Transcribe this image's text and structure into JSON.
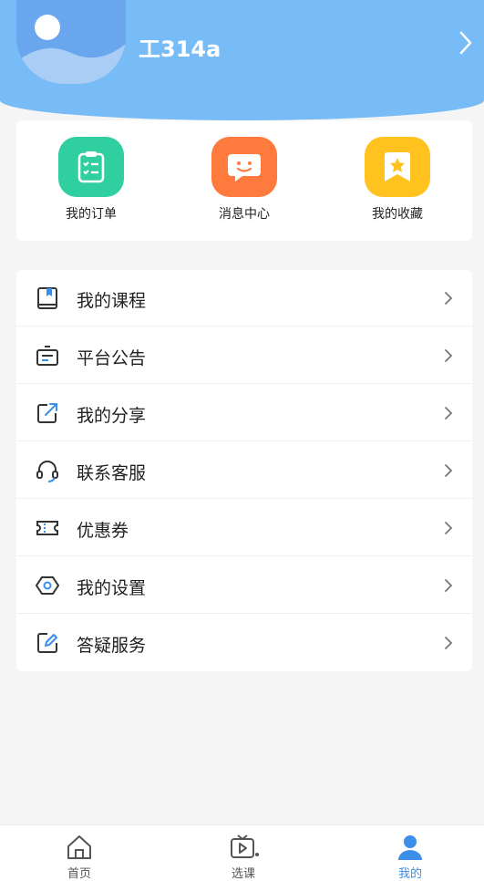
{
  "profile": {
    "username": "工314a"
  },
  "quick_actions": [
    {
      "label": "我的订单",
      "icon": "clipboard-list-icon",
      "color": "#2fcf9f"
    },
    {
      "label": "消息中心",
      "icon": "chat-bubble-icon",
      "color": "#ff7a3d"
    },
    {
      "label": "我的收藏",
      "icon": "bookmark-star-icon",
      "color": "#ffc21f"
    }
  ],
  "menu": [
    {
      "label": "我的课程",
      "icon": "book-icon"
    },
    {
      "label": "平台公告",
      "icon": "notice-board-icon"
    },
    {
      "label": "我的分享",
      "icon": "share-icon"
    },
    {
      "label": "联系客服",
      "icon": "headset-icon"
    },
    {
      "label": "优惠券",
      "icon": "coupon-icon"
    },
    {
      "label": "我的设置",
      "icon": "settings-hexagon-icon"
    },
    {
      "label": "答疑服务",
      "icon": "edit-icon"
    }
  ],
  "tabbar": {
    "items": [
      {
        "label": "首页",
        "icon": "home-icon"
      },
      {
        "label": "选课",
        "icon": "tv-play-icon"
      },
      {
        "label": "我的",
        "icon": "user-icon",
        "active": true
      }
    ]
  },
  "colors": {
    "header": "#78bcf7",
    "accent": "#3b8fe8"
  }
}
